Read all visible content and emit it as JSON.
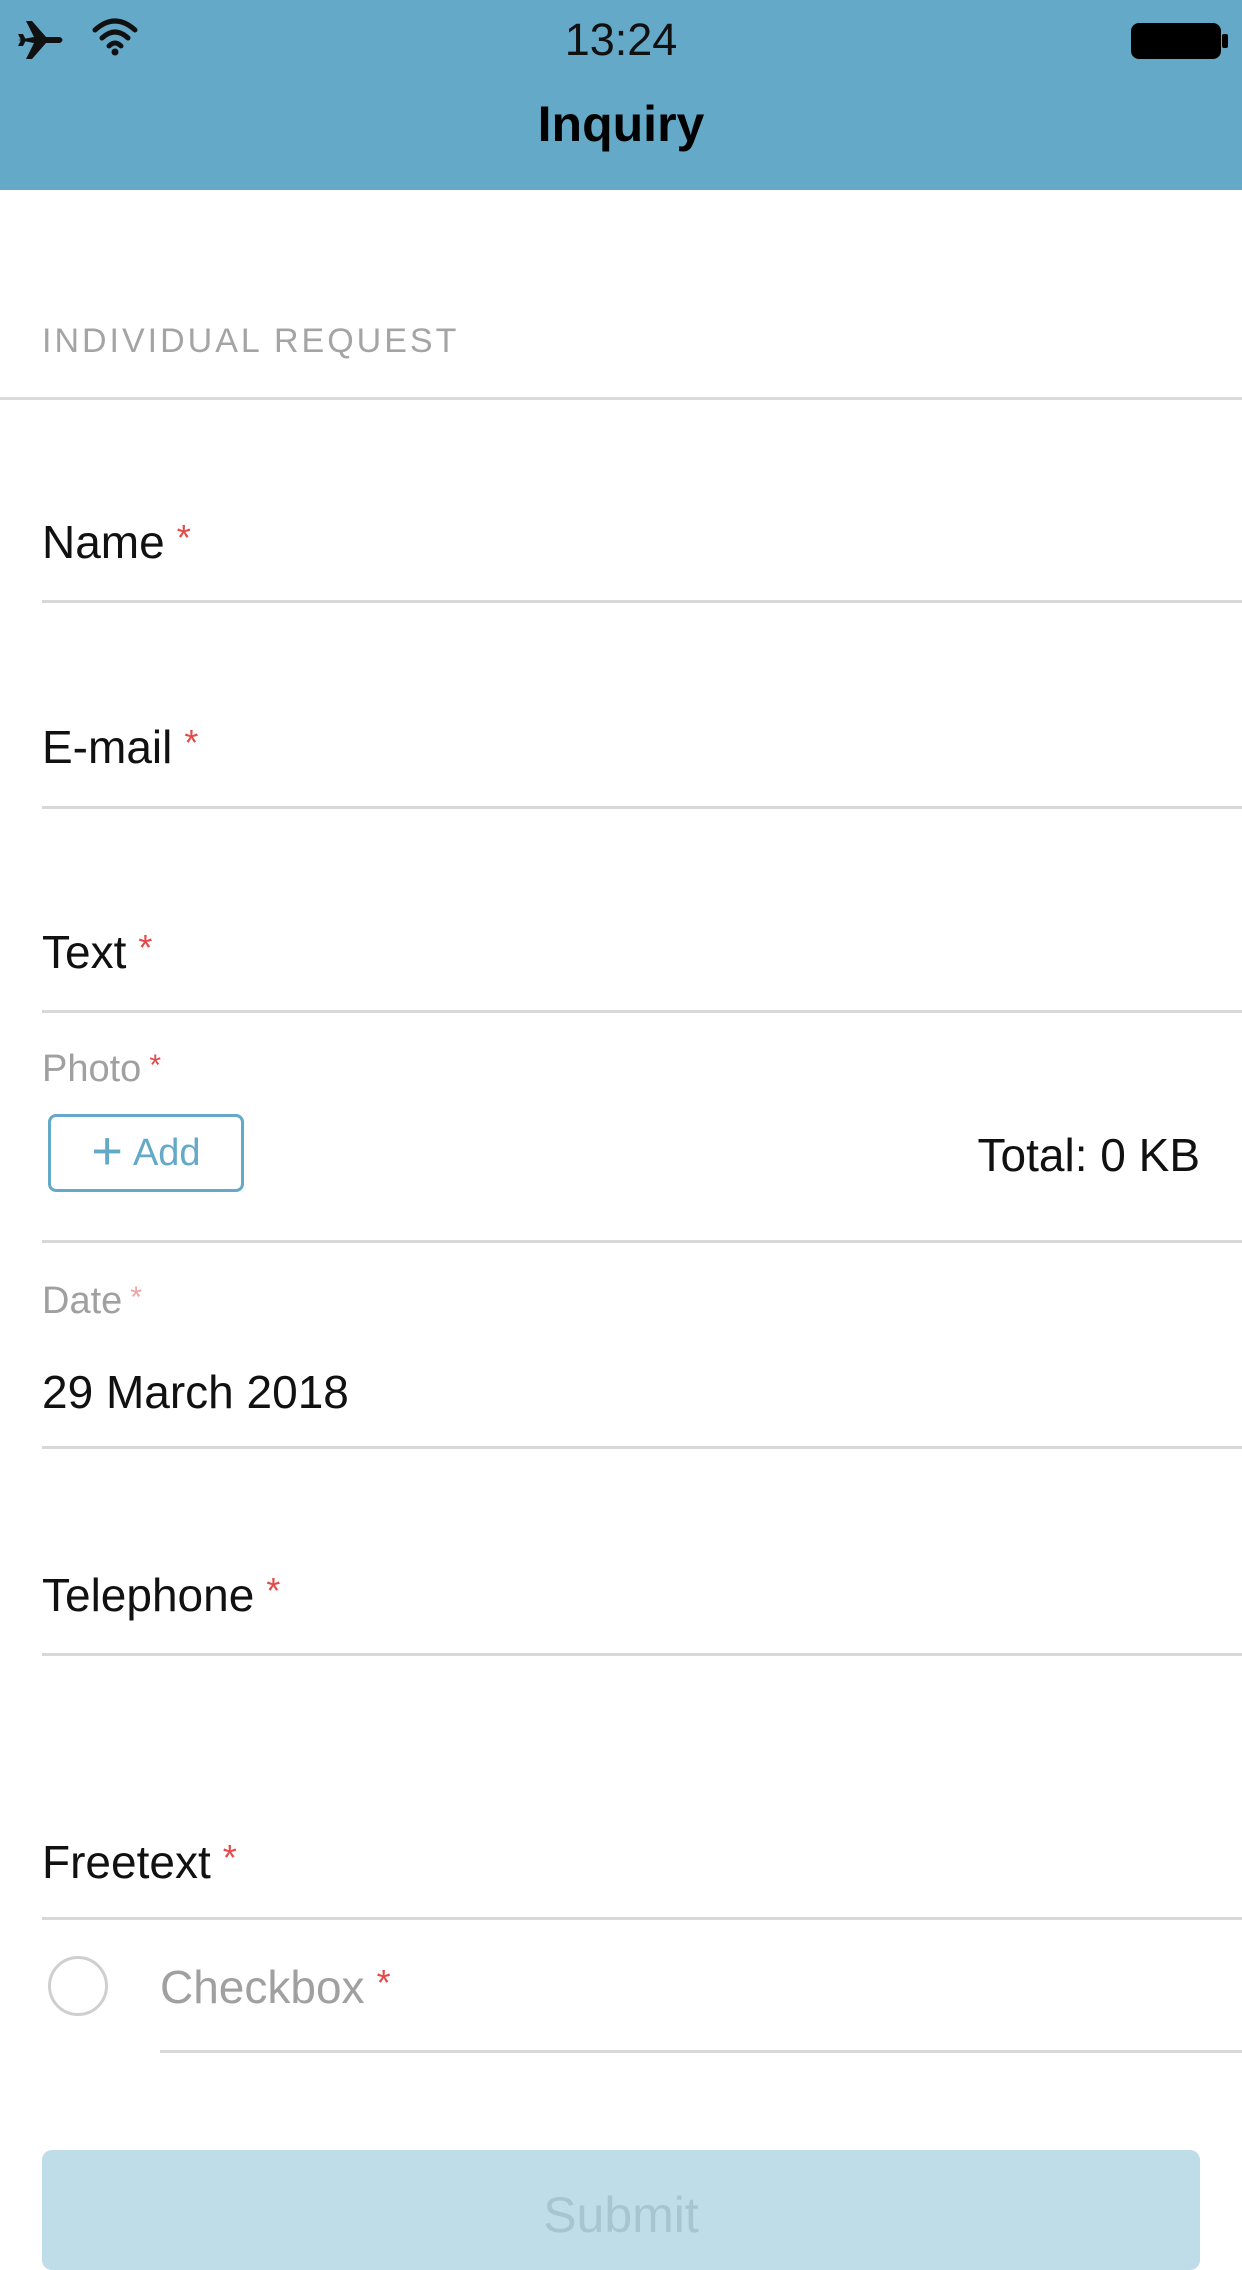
{
  "status_bar": {
    "time": "13:24",
    "icons": [
      "airplane-icon",
      "wifi-icon",
      "battery-icon"
    ]
  },
  "header": {
    "title": "Inquiry",
    "background_color": "#64a9c7"
  },
  "form": {
    "section_title": "INDIVIDUAL REQUEST",
    "required_marker": "*",
    "required_color": "#e34a4a",
    "fields": {
      "name": {
        "label": "Name"
      },
      "email": {
        "label": "E-mail"
      },
      "text": {
        "label": "Text"
      },
      "photo": {
        "label": "Photo",
        "add_label": "Add",
        "total": "Total: 0 KB"
      },
      "date": {
        "label": "Date",
        "value": "29 March 2018"
      },
      "telephone": {
        "label": "Telephone"
      },
      "freetext": {
        "label": "Freetext"
      },
      "checkbox": {
        "label": "Checkbox",
        "checked": false
      }
    },
    "submit_label": "Submit"
  }
}
